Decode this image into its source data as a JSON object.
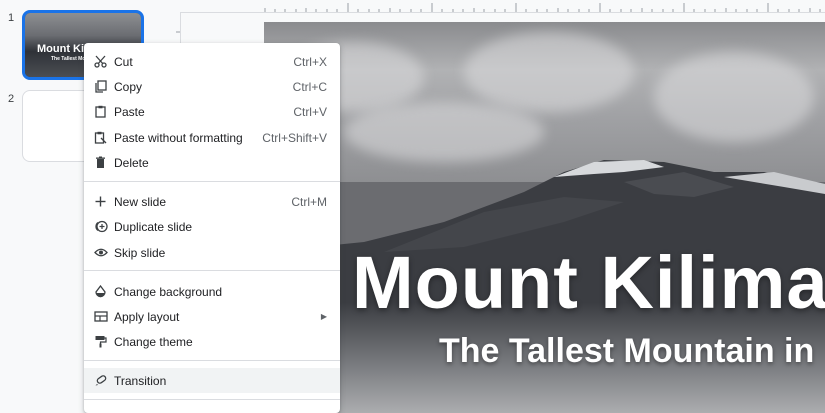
{
  "filmstrip": {
    "slides": [
      {
        "number": "1",
        "title": "Mount Kilimanjaro",
        "subtitle": "The Tallest Mountain in Africa"
      },
      {
        "number": "2"
      }
    ]
  },
  "slide": {
    "title": "Mount Kilima",
    "subtitle": "The Tallest Mountain in"
  },
  "context_menu": {
    "cut": {
      "label": "Cut",
      "shortcut": "Ctrl+X"
    },
    "copy": {
      "label": "Copy",
      "shortcut": "Ctrl+C"
    },
    "paste": {
      "label": "Paste",
      "shortcut": "Ctrl+V"
    },
    "paste_plain": {
      "label": "Paste without formatting",
      "shortcut": "Ctrl+Shift+V"
    },
    "delete": {
      "label": "Delete"
    },
    "new_slide": {
      "label": "New slide",
      "shortcut": "Ctrl+M"
    },
    "duplicate_slide": {
      "label": "Duplicate slide"
    },
    "skip_slide": {
      "label": "Skip slide"
    },
    "change_background": {
      "label": "Change background"
    },
    "apply_layout": {
      "label": "Apply layout"
    },
    "change_theme": {
      "label": "Change theme"
    },
    "transition": {
      "label": "Transition"
    }
  },
  "colors": {
    "accent": "#1a73e8",
    "highlight": "#f1f3f4"
  }
}
